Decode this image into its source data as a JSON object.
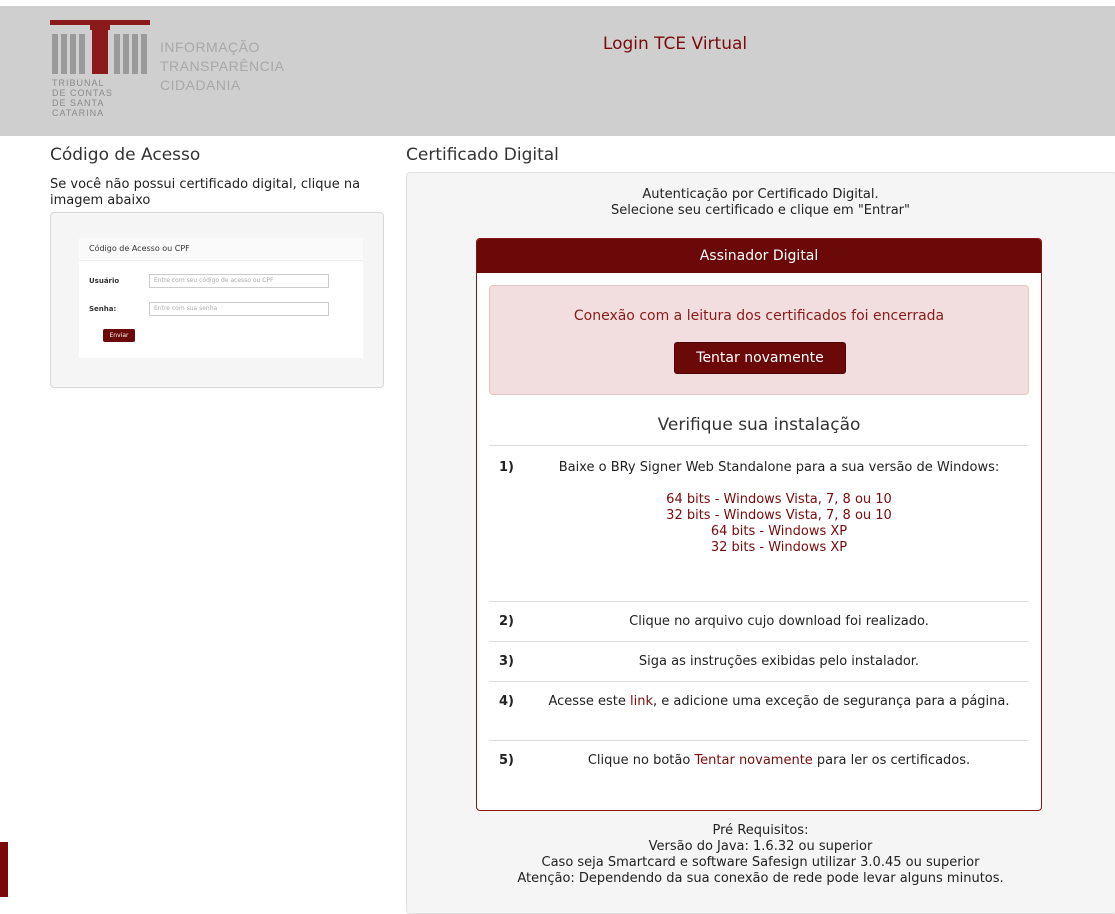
{
  "header": {
    "title": "Login TCE Virtual",
    "logo_words": [
      "INFORMAÇÃO",
      "TRANSPARÊNCIA",
      "CIDADANIA"
    ],
    "logo_org": [
      "TRIBUNAL",
      "DE CONTAS",
      "DE SANTA",
      "CATARINA"
    ]
  },
  "left": {
    "heading": "Código de Acesso",
    "description": "Se você não possui certificado digital, clique na imagem abaixo",
    "mini_form": {
      "title": "Código de Acesso ou CPF",
      "user_label": "Usuário",
      "user_placeholder": "Entre com seu código de acesso ou CPF",
      "pass_label": "Senha:",
      "pass_placeholder": "Entre com sua senha",
      "submit_label": "Enviar"
    }
  },
  "right": {
    "heading": "Certificado Digital",
    "intro_line1": "Autenticação por Certificado Digital.",
    "intro_line2": "Selecione seu certificado e clique em \"Entrar\"",
    "signer": {
      "title": "Assinador Digital",
      "alert_text": "Conexão com a leitura dos certificados foi encerrada",
      "retry_label": "Tentar novamente",
      "verify_title": "Verifique sua instalação",
      "steps": {
        "s1": {
          "num": "1)",
          "text": "Baixe o BRy Signer Web Standalone para a sua versão de Windows:",
          "links": [
            "64 bits - Windows Vista, 7, 8 ou 10",
            "32 bits - Windows Vista, 7, 8 ou 10",
            "64 bits - Windows XP",
            "32 bits - Windows XP"
          ]
        },
        "s2": {
          "num": "2)",
          "text": "Clique no arquivo cujo download foi realizado."
        },
        "s3": {
          "num": "3)",
          "text": "Siga as instruções exibidas pelo instalador."
        },
        "s4": {
          "num": "4)",
          "pre": "Acesse este ",
          "link": "link",
          "post": ", e adicione uma exceção de segurança para a página."
        },
        "s5": {
          "num": "5)",
          "pre": "Clique no botão ",
          "link": "Tentar novamente",
          "post": " para ler os certificados."
        }
      }
    },
    "prereq": {
      "title": "Pré Requisitos:",
      "java": "Versão do Java: 1.6.32 ou superior",
      "smartcard": "Caso seja Smartcard e software Safesign utilizar 3.0.45 ou superior",
      "warning": "Atenção: Dependendo da sua conexão de rede pode levar alguns minutos."
    }
  },
  "colors": {
    "brand": "#6b0808",
    "link": "#7a0b0b",
    "alert_bg": "#f2dede",
    "header_bg": "#cfcfcf"
  }
}
